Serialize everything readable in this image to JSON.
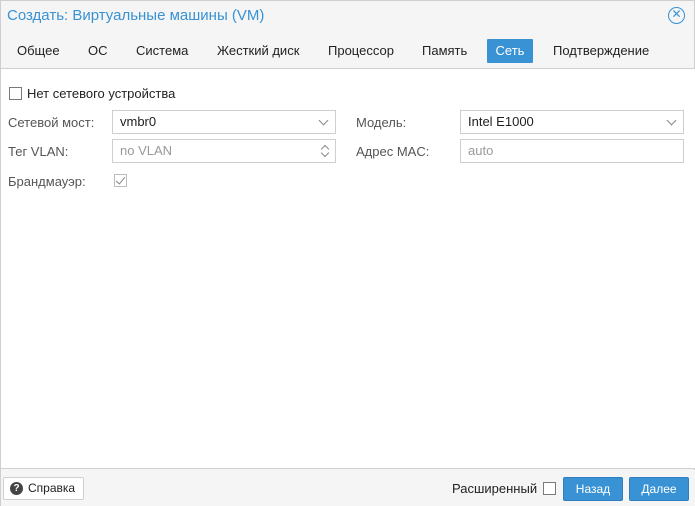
{
  "window": {
    "title": "Создать: Виртуальные машины (VM)",
    "close_glyph": "✕"
  },
  "tabs": [
    {
      "label": "Общее",
      "active": false
    },
    {
      "label": "ОС",
      "active": false
    },
    {
      "label": "Система",
      "active": false
    },
    {
      "label": "Жесткий диск",
      "active": false
    },
    {
      "label": "Процессор",
      "active": false
    },
    {
      "label": "Память",
      "active": false
    },
    {
      "label": "Сеть",
      "active": true
    },
    {
      "label": "Подтверждение",
      "active": false
    }
  ],
  "form": {
    "no_network_label": "Нет сетевого устройства",
    "no_network_checked": false,
    "bridge_label": "Сетевой мост:",
    "bridge_value": "vmbr0",
    "model_label": "Модель:",
    "model_value": "Intel E1000",
    "vlan_label": "Тег VLAN:",
    "vlan_placeholder": "no VLAN",
    "mac_label": "Адрес MAC:",
    "mac_placeholder": "auto",
    "firewall_label": "Брандмауэр:",
    "firewall_checked": true
  },
  "footer": {
    "help_label": "Справка",
    "help_glyph": "?",
    "advanced_label": "Расширенный",
    "advanced_checked": false,
    "back_label": "Назад",
    "next_label": "Далее"
  },
  "colors": {
    "accent": "#3892d4"
  }
}
